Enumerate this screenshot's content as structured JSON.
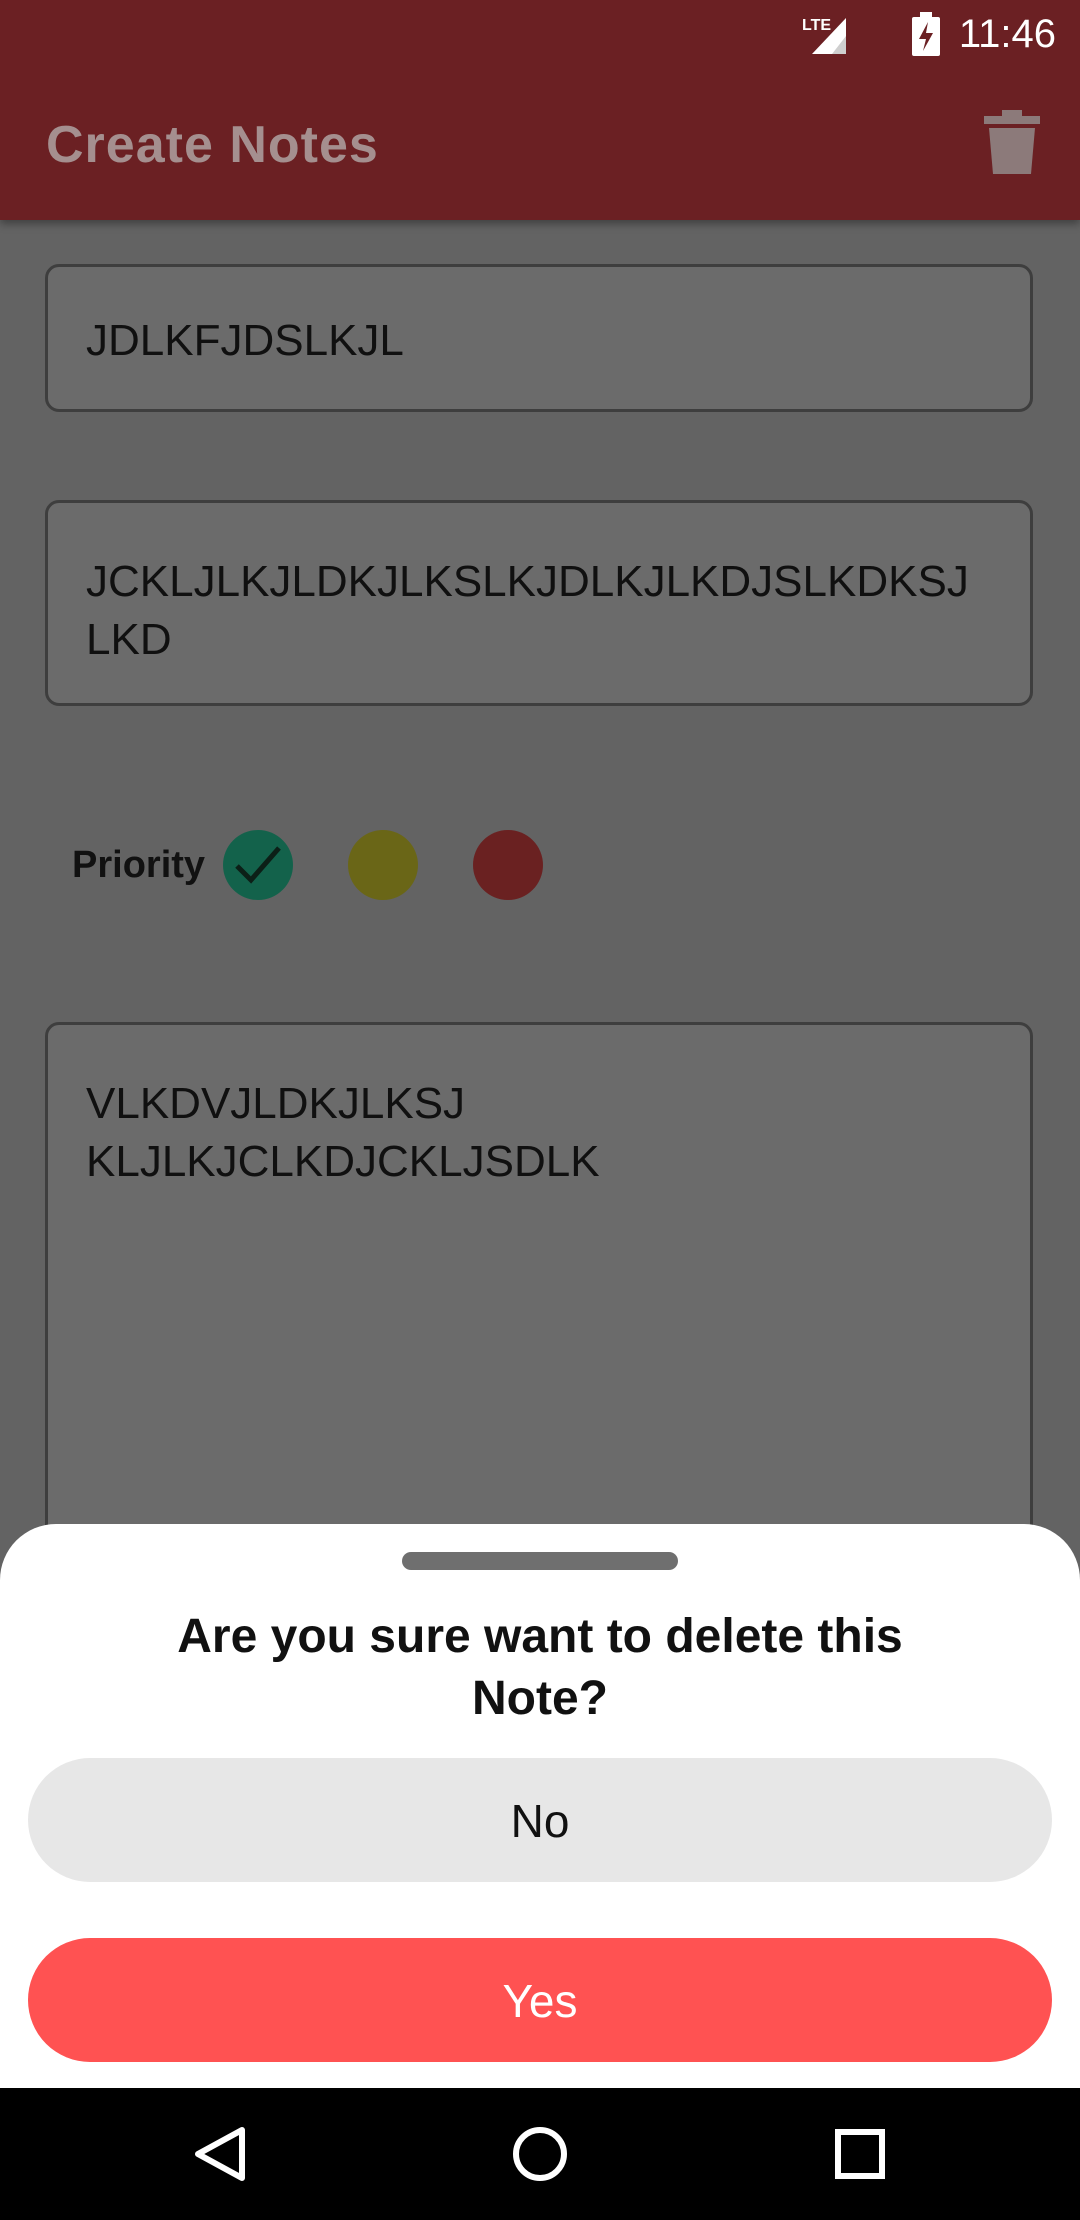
{
  "status_bar": {
    "time": "11:46",
    "network_label": "LTE",
    "icons": [
      "lte-signal-icon",
      "battery-charging-icon"
    ]
  },
  "app_bar": {
    "title": "Create Notes",
    "action_icon": "trash-icon"
  },
  "form": {
    "title_value": "JDLKFJDSLKJL",
    "subtitle_value": "JCKLJLKJLDKJLKSLKJDLKJLKDJSLKDKSJLKD",
    "priority_label": "Priority",
    "priority_options": [
      {
        "name": "green",
        "color": "#13624b",
        "selected": true
      },
      {
        "name": "yellow",
        "color": "#6a6617",
        "selected": false
      },
      {
        "name": "red",
        "color": "#6a2121",
        "selected": false
      }
    ],
    "note_value": "VLKDVJLDKJLKSJ\nKLJLKJCLKDJCKLJSDLK"
  },
  "dialog": {
    "question": "Are you sure want to delete this Note?",
    "no_label": "No",
    "yes_label": "Yes"
  },
  "colors": {
    "app_bar": "#6b2023",
    "overlay_background": "#636363",
    "yes_button": "#ff5252",
    "no_button": "#e7e7e7"
  },
  "nav_bar": {
    "buttons": [
      "back-icon",
      "home-icon",
      "recents-icon"
    ]
  }
}
